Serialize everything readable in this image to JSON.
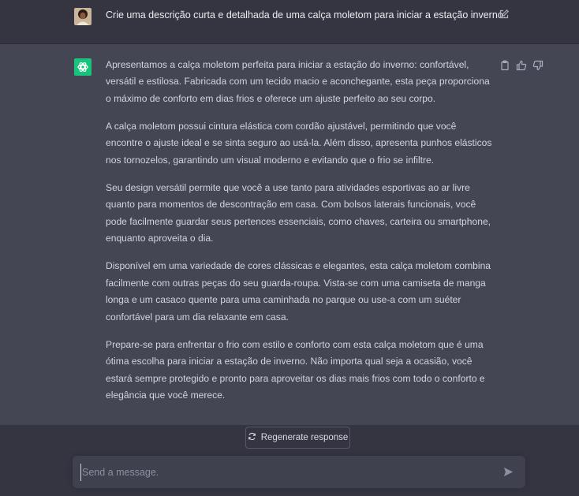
{
  "user_message": {
    "text": "Crie uma descrição curta e detalhada de uma calça moletom para iniciar a estação inverno.",
    "avatar_icon": "user-avatar",
    "edit_icon": "edit-icon"
  },
  "assistant_message": {
    "logo_icon": "openai-logo-icon",
    "paragraphs": [
      "Apresentamos a calça moletom perfeita para iniciar a estação do inverno: confortável, versátil e estilosa. Fabricada com um tecido macio e aconchegante, esta peça proporciona o máximo de conforto em dias frios e oferece um ajuste perfeito ao seu corpo.",
      "A calça moletom possui cintura elástica com cordão ajustável, permitindo que você encontre o ajuste ideal e se sinta seguro ao usá-la. Além disso, apresenta punhos elásticos nos tornozelos, garantindo um visual moderno e evitando que o frio se infiltre.",
      "Seu design versátil permite que você a use tanto para atividades esportivas ao ar livre quanto para momentos de descontração em casa. Com bolsos laterais funcionais, você pode facilmente guardar seus pertences essenciais, como chaves, carteira ou smartphone, enquanto aproveita o dia.",
      "Disponível em uma variedade de cores clássicas e elegantes, esta calça moletom combina facilmente com outras peças do seu guarda-roupa. Vista-se com uma camiseta de manga longa e um casaco quente para uma caminhada no parque ou use-a com um suéter confortável para um dia relaxante em casa.",
      "Prepare-se para enfrentar o frio com estilo e conforto com esta calça moletom que é uma ótima escolha para iniciar a estação de inverno. Não importa qual seja a ocasião, você estará sempre protegido e pronto para aproveitar os dias mais frios com todo o conforto e elegância que você merece."
    ],
    "action_icons": [
      "copy-icon",
      "thumbs-up-icon",
      "thumbs-down-icon"
    ]
  },
  "regenerate": {
    "label": "Regenerate response",
    "icon": "refresh-icon"
  },
  "composer": {
    "placeholder": "Send a message.",
    "send_icon": "send-icon"
  },
  "colors": {
    "background": "#343541",
    "assistant_background": "#444654",
    "input_background": "#40414f",
    "brand_green": "#19c37d"
  }
}
